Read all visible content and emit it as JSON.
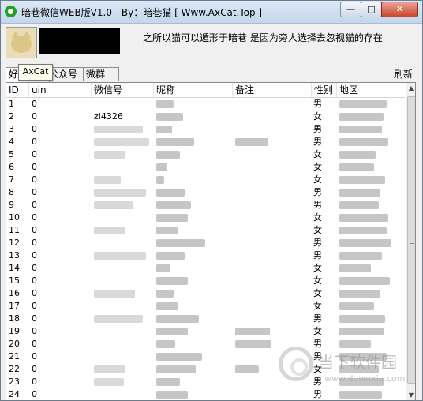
{
  "window": {
    "title": "暗巷微信WEB版V1.0 - By：暗巷猫 [ Www.AxCat.Top ]",
    "min_label": "—",
    "max_label": "□",
    "close_label": "✕"
  },
  "header": {
    "motto": "之所以猫可以遁形于暗巷 是因为旁人选择去忽视猫的存在",
    "tooltip": "AxCat"
  },
  "tabs": [
    {
      "label": "好友"
    },
    {
      "label": "公众号"
    },
    {
      "label": "微群"
    }
  ],
  "refresh_label": "刷新",
  "table": {
    "headers": [
      "ID",
      "uin",
      "微信号",
      "昵称",
      "备注",
      "性别",
      "地区"
    ],
    "rows": [
      {
        "id": "1",
        "uin": "0",
        "wxid": "",
        "gender": "男"
      },
      {
        "id": "2",
        "uin": "0",
        "wxid": "zl4326",
        "gender": "女"
      },
      {
        "id": "3",
        "uin": "0",
        "wxid": "",
        "gender": "男"
      },
      {
        "id": "4",
        "uin": "0",
        "wxid": "",
        "gender": "男"
      },
      {
        "id": "5",
        "uin": "0",
        "wxid": "",
        "gender": "女"
      },
      {
        "id": "6",
        "uin": "0",
        "wxid": "",
        "gender": "女"
      },
      {
        "id": "7",
        "uin": "0",
        "wxid": "",
        "gender": "女"
      },
      {
        "id": "8",
        "uin": "0",
        "wxid": "",
        "gender": "男"
      },
      {
        "id": "9",
        "uin": "0",
        "wxid": "",
        "gender": "男"
      },
      {
        "id": "10",
        "uin": "0",
        "wxid": "",
        "gender": "女"
      },
      {
        "id": "11",
        "uin": "0",
        "wxid": "",
        "gender": "女"
      },
      {
        "id": "12",
        "uin": "0",
        "wxid": "",
        "gender": "男"
      },
      {
        "id": "13",
        "uin": "0",
        "wxid": "",
        "gender": "男"
      },
      {
        "id": "14",
        "uin": "0",
        "wxid": "",
        "gender": "女"
      },
      {
        "id": "15",
        "uin": "0",
        "wxid": "",
        "gender": "女"
      },
      {
        "id": "16",
        "uin": "0",
        "wxid": "",
        "gender": "女"
      },
      {
        "id": "17",
        "uin": "0",
        "wxid": "",
        "gender": "女"
      },
      {
        "id": "18",
        "uin": "0",
        "wxid": "",
        "gender": "男"
      },
      {
        "id": "19",
        "uin": "0",
        "wxid": "",
        "gender": "女"
      },
      {
        "id": "20",
        "uin": "0",
        "wxid": "",
        "gender": "男"
      },
      {
        "id": "21",
        "uin": "0",
        "wxid": "",
        "gender": "男"
      },
      {
        "id": "22",
        "uin": "0",
        "wxid": "",
        "gender": "女"
      },
      {
        "id": "23",
        "uin": "0",
        "wxid": "",
        "gender": "男"
      },
      {
        "id": "24",
        "uin": "0",
        "wxid": "",
        "gender": "男"
      }
    ]
  },
  "watermark": {
    "text": "当下软件园",
    "url": "www.downxia.com"
  },
  "icons": {
    "app": "wechat-icon",
    "scroll_up": "▲",
    "scroll_down": "▼"
  }
}
